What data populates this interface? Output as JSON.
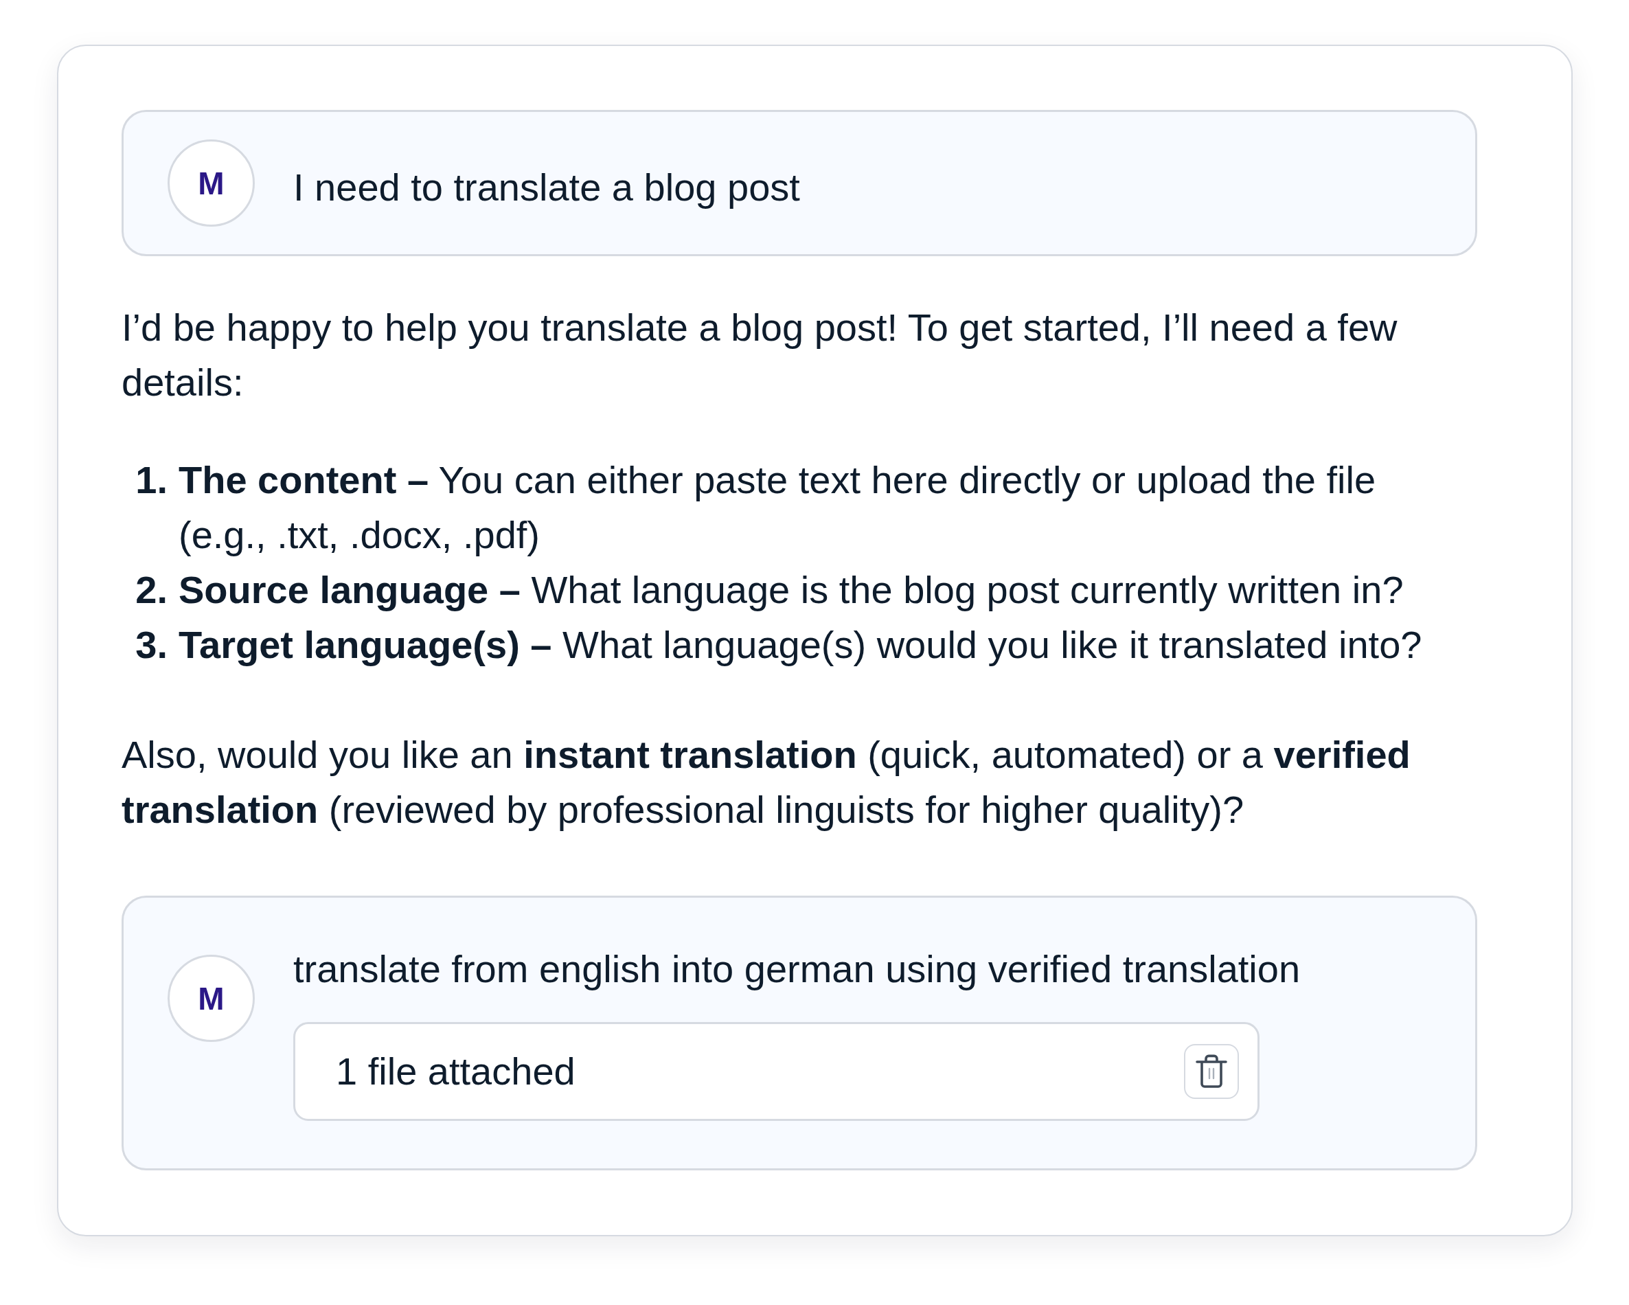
{
  "conversation": [
    {
      "kind": "user",
      "avatar": "M",
      "text": "I need to translate a blog post"
    },
    {
      "kind": "assistant",
      "blocks": [
        {
          "kind": "paragraph",
          "text": "I’d be happy to help you translate a blog post! To get started, I’ll need a few details:"
        },
        {
          "kind": "list",
          "items": [
            {
              "number": "1.",
              "text": "**The content –** You can either paste text here directly or upload the file (e.g., .txt, .docx, .pdf)"
            },
            {
              "number": "2.",
              "text": "**Source language –** What language is the blog post currently written in?"
            },
            {
              "number": "3.",
              "text": "**Target language(s) –** What language(s) would you like it translated into?"
            }
          ]
        },
        {
          "kind": "paragraph",
          "text": "Also, would you like an **instant translation** (quick, automated) or a **verified translation** (reviewed by professional linguists for higher quality)?"
        }
      ]
    },
    {
      "kind": "user",
      "avatar": "M",
      "text": "translate from english into german using verified translation",
      "attachment": {
        "label": "1 file attached"
      }
    }
  ]
}
